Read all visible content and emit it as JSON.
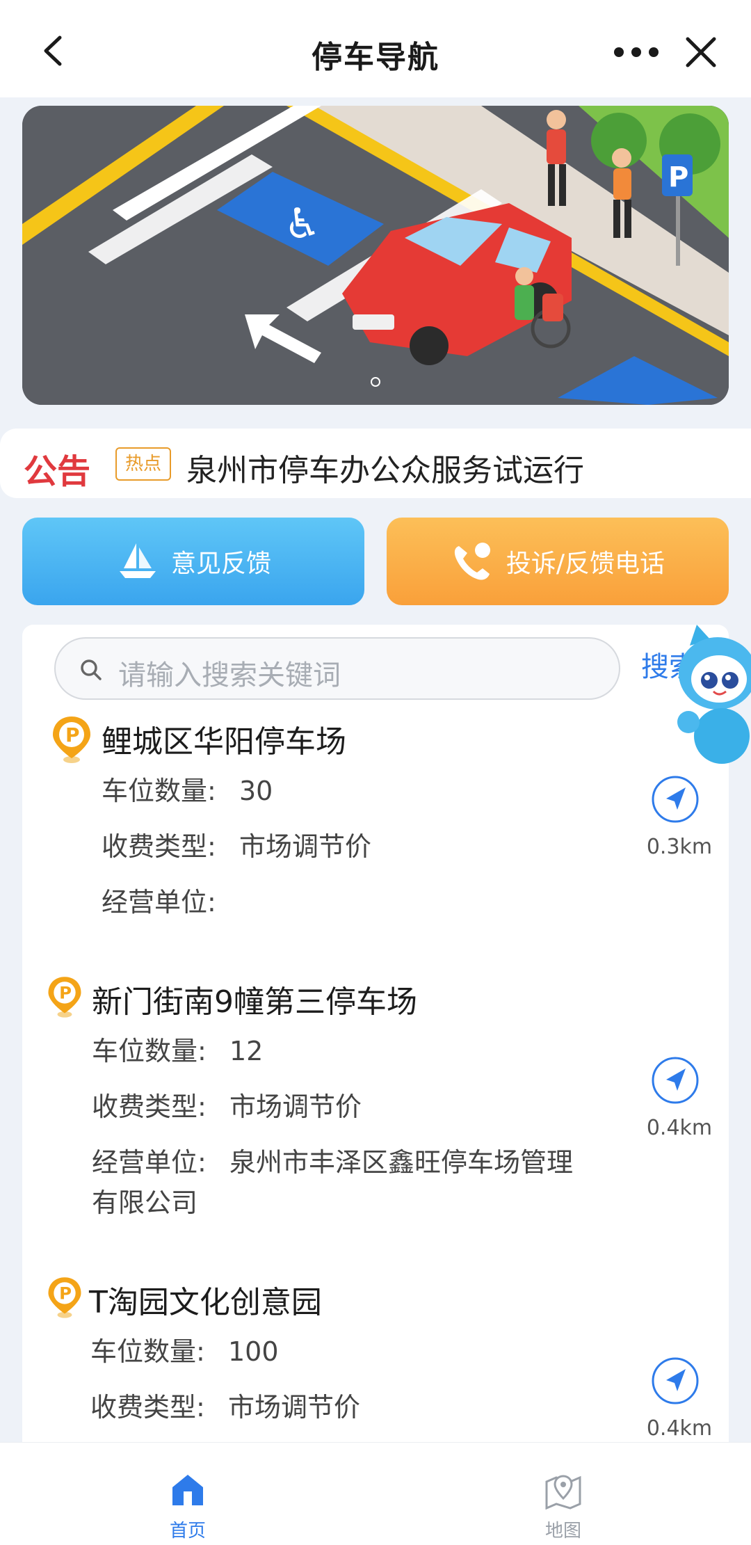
{
  "header": {
    "title": "停车导航",
    "back_icon": "chevron-left-icon",
    "more_icon": "more-dots-icon",
    "close_icon": "close-icon"
  },
  "banner": {
    "image": "accessible-parking-illustration",
    "carousel_index": 1,
    "carousel_total": 1
  },
  "notice": {
    "label": "公告",
    "tag": "热点",
    "text": "泉州市停车办公众服务试运行"
  },
  "actions": {
    "feedback_label": "意见反馈",
    "feedback_icon": "boat-icon",
    "phone_label": "投诉/反馈电话",
    "phone_icon": "phone-icon"
  },
  "search": {
    "placeholder": "请输入搜索关键词",
    "button_label": "搜索"
  },
  "lots": [
    {
      "name": "鲤城区华阳停车场",
      "spaces_label": "车位数量:",
      "spaces": "30",
      "fee_label": "收费类型:",
      "fee": "市场调节价",
      "operator_label": "经营单位:",
      "operator": "",
      "distance": "0.3km"
    },
    {
      "name": "新门街南9幢第三停车场",
      "spaces_label": "车位数量:",
      "spaces": "12",
      "fee_label": "收费类型:",
      "fee": "市场调节价",
      "operator_label": "经营单位:",
      "operator": "泉州市丰泽区鑫旺停车场管理",
      "operator_cont": "有限公司",
      "distance": "0.4km"
    },
    {
      "name": "T淘园文化创意园",
      "spaces_label": "车位数量:",
      "spaces": "100",
      "fee_label": "收费类型:",
      "fee": "市场调节价",
      "distance": "0.4km"
    }
  ],
  "tabbar": {
    "home_label": "首页",
    "home_icon": "home-icon",
    "map_label": "地图",
    "map_icon": "map-pin-icon"
  },
  "colors": {
    "accent": "#2e7bea",
    "notice_red": "#e0393e",
    "hot_orange": "#e89b2a",
    "feedback_blue": "#3aa5ee",
    "phone_orange": "#f9a03a",
    "pin_orange": "#f4a417"
  }
}
